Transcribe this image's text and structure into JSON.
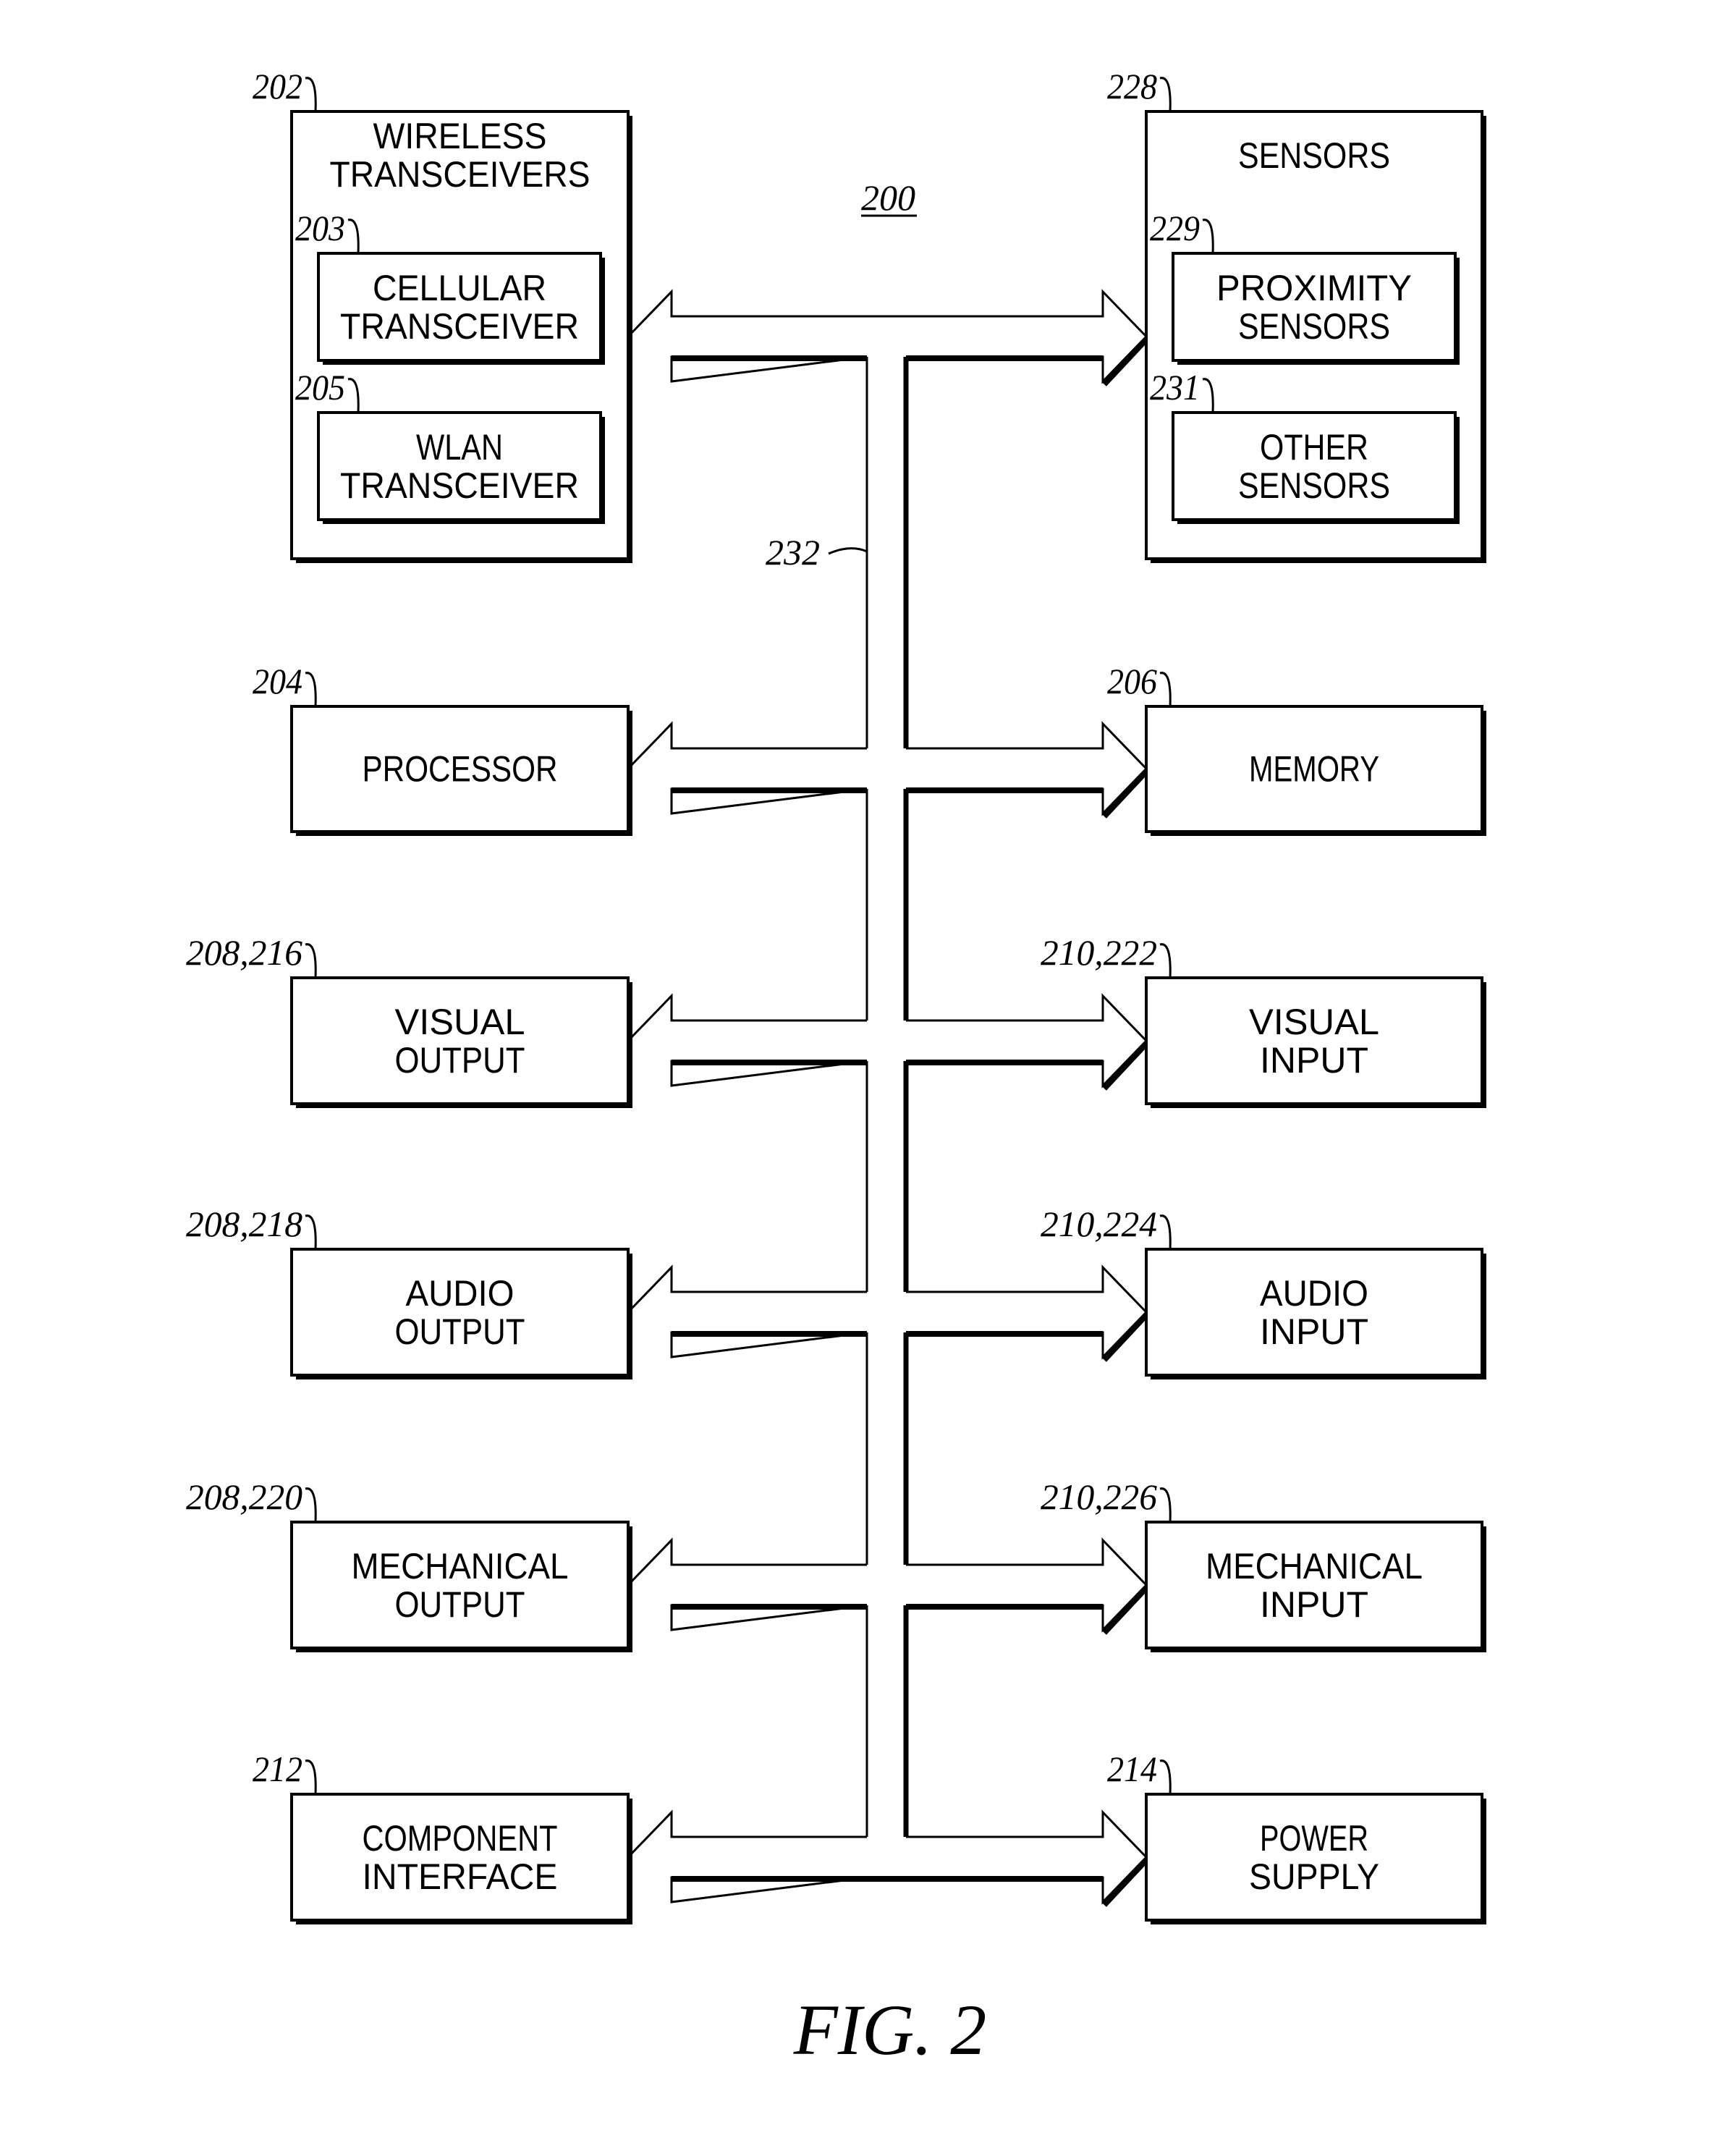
{
  "figure": {
    "caption": "FIG. 2",
    "system_ref": "200",
    "bus_ref": "232"
  },
  "blocks": {
    "wireless": {
      "ref": "202",
      "lines": [
        "WIRELESS",
        "TRANSCEIVERS"
      ]
    },
    "cellular": {
      "ref": "203",
      "lines": [
        "CELLULAR",
        "TRANSCEIVER"
      ]
    },
    "wlan": {
      "ref": "205",
      "lines": [
        "WLAN",
        "TRANSCEIVER"
      ]
    },
    "sensors": {
      "ref": "228",
      "lines": [
        "SENSORS"
      ]
    },
    "proximity": {
      "ref": "229",
      "lines": [
        "PROXIMITY",
        "SENSORS"
      ]
    },
    "other_sensors": {
      "ref": "231",
      "lines": [
        "OTHER",
        "SENSORS"
      ]
    },
    "processor": {
      "ref": "204",
      "lines": [
        "PROCESSOR"
      ]
    },
    "memory": {
      "ref": "206",
      "lines": [
        "MEMORY"
      ]
    },
    "visual_output": {
      "ref": "208,216",
      "lines": [
        "VISUAL",
        "OUTPUT"
      ]
    },
    "visual_input": {
      "ref": "210,222",
      "lines": [
        "VISUAL",
        "INPUT"
      ]
    },
    "audio_output": {
      "ref": "208,218",
      "lines": [
        "AUDIO",
        "OUTPUT"
      ]
    },
    "audio_input": {
      "ref": "210,224",
      "lines": [
        "AUDIO",
        "INPUT"
      ]
    },
    "mechanical_output": {
      "ref": "208,220",
      "lines": [
        "MECHANICAL",
        "OUTPUT"
      ]
    },
    "mechanical_input": {
      "ref": "210,226",
      "lines": [
        "MECHANICAL",
        "INPUT"
      ]
    },
    "component_interface": {
      "ref": "212",
      "lines": [
        "COMPONENT",
        "INTERFACE"
      ]
    },
    "power_supply": {
      "ref": "214",
      "lines": [
        "POWER",
        "SUPPLY"
      ]
    }
  }
}
